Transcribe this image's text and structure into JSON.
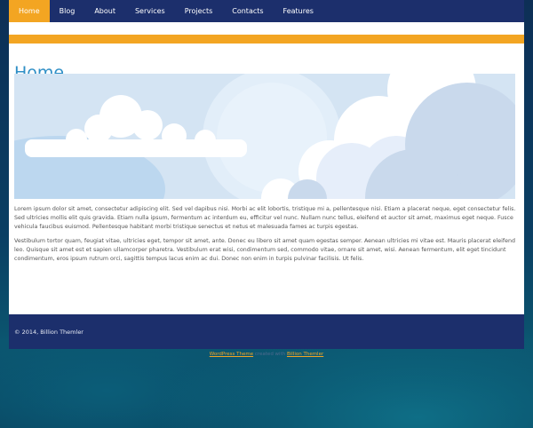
{
  "nav": {
    "items": [
      {
        "label": "Home",
        "active": true
      },
      {
        "label": "Blog"
      },
      {
        "label": "About"
      },
      {
        "label": "Services"
      },
      {
        "label": "Projects"
      },
      {
        "label": "Contacts"
      },
      {
        "label": "Features"
      }
    ]
  },
  "main": {
    "title": "Home",
    "paragraphs": [
      "Lorem ipsum dolor sit amet, consectetur adipiscing elit. Sed vel dapibus nisi. Morbi ac elit lobortis, tristique mi a, pellentesque nisi. Etiam a placerat neque, eget consectetur felis. Sed ultricies mollis elit quis gravida. Etiam nulla ipsum, fermentum ac interdum eu, efficitur vel nunc. Nullam nunc tellus, eleifend et auctor sit amet, maximus eget neque. Fusce vehicula faucibus euismod. Pellentesque habitant morbi tristique senectus et netus et malesuada fames ac turpis egestas.",
      "Vestibulum tortor quam, feugiat vitae, ultricies eget, tempor sit amet, ante. Donec eu libero sit amet quam egestas semper. Aenean ultricies mi vitae est. Mauris placerat eleifend leo. Quisque sit amet est et sapien ullamcorper pharetra. Vestibulum erat wisi, condimentum sed, commodo vitae, ornare sit amet, wisi. Aenean fermentum, elit eget tincidunt condimentum, eros ipsum rutrum orci, sagittis tempus lacus enim ac dui. Donec non enim in turpis pulvinar facilisis. Ut felis."
    ]
  },
  "footer": {
    "copyright": "© 2014, Billion Themler"
  },
  "credits": {
    "link1": "WordPress Theme",
    "middle": "created with",
    "link2": "Billion Themler"
  },
  "colors": {
    "nav_bg": "#1c2f6c",
    "accent": "#f3a522",
    "title": "#2f8fc6"
  }
}
